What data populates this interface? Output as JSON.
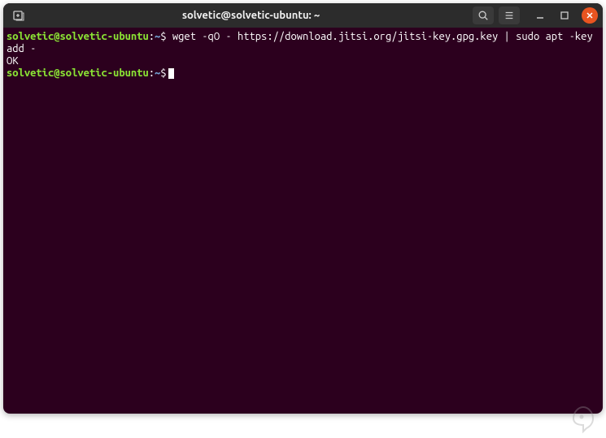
{
  "titlebar": {
    "title": "solvetic@solvetic-ubuntu: ~"
  },
  "terminal": {
    "line1": {
      "user": "solvetic@solvetic-ubuntu",
      "sep": ":",
      "path": "~",
      "dollar": "$",
      "command": " wget -qO - https://download.jitsi.org/jitsi-key.gpg.key | sudo apt -key add -"
    },
    "line2": {
      "output": "OK"
    },
    "line3": {
      "user": "solvetic@solvetic-ubuntu",
      "sep": ":",
      "path": "~",
      "dollar": "$"
    }
  }
}
